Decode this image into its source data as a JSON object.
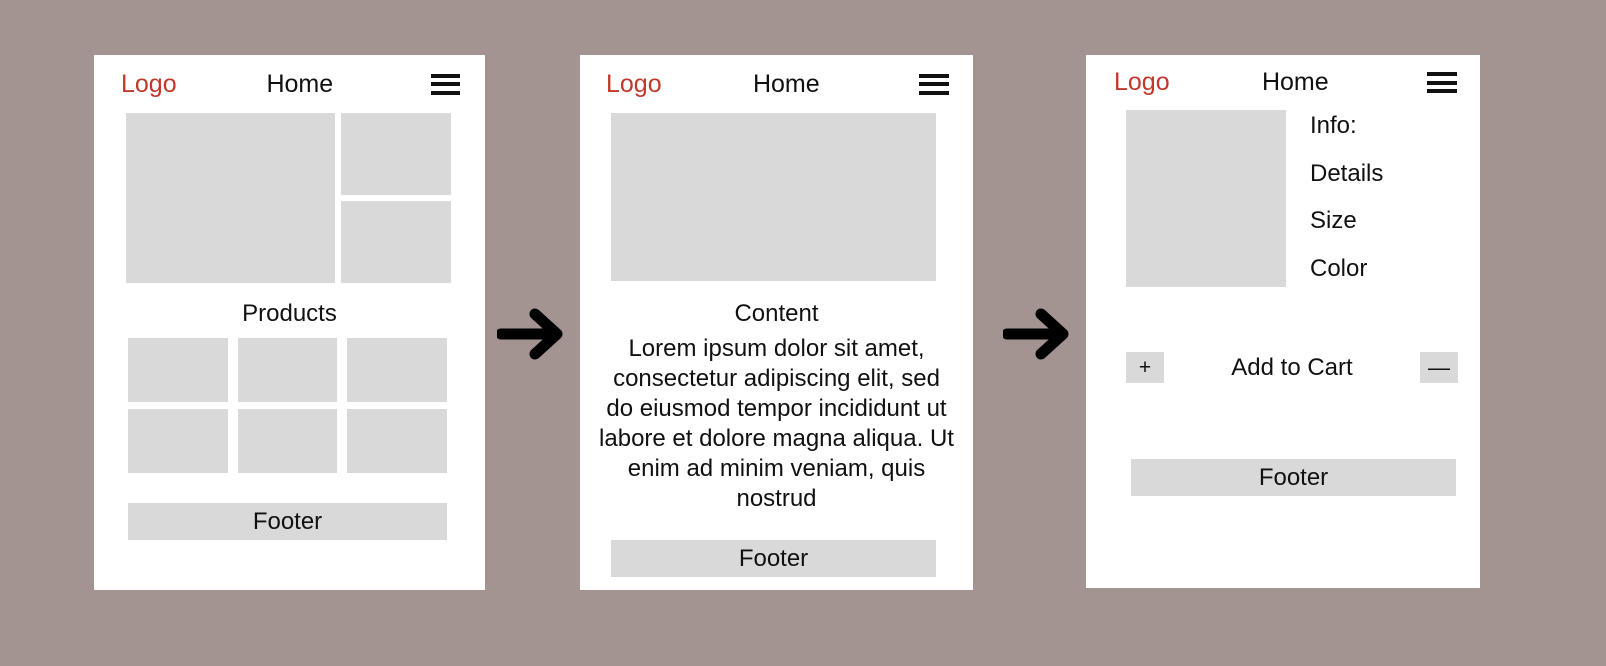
{
  "canvas": {
    "background_color": "#a39391",
    "placeholder_color": "#d9d9d9",
    "accent_color": "#c0392b",
    "text_color": "#111111"
  },
  "flow": {
    "arrow_1": "→",
    "arrow_2": "→"
  },
  "screens": [
    {
      "id": "home",
      "header": {
        "logo": "Logo",
        "nav_title": "Home",
        "menu_icon": "hamburger-icon"
      },
      "hero": {
        "main_placeholder": "",
        "side_placeholders": [
          "",
          ""
        ]
      },
      "section_title": "Products",
      "products": [
        "",
        "",
        "",
        "",
        "",
        ""
      ],
      "footer": "Footer"
    },
    {
      "id": "content",
      "header": {
        "logo": "Logo",
        "nav_title": "Home",
        "menu_icon": "hamburger-icon"
      },
      "hero": {
        "main_placeholder": ""
      },
      "section_title": "Content",
      "body_copy": "Lorem ipsum dolor sit amet, consectetur adipiscing elit, sed do eiusmod tempor incididunt ut labore et dolore magna aliqua. Ut enim ad minim veniam, quis nostrud",
      "footer": "Footer"
    },
    {
      "id": "product-detail",
      "header": {
        "logo": "Logo",
        "nav_title": "Home",
        "menu_icon": "hamburger-icon"
      },
      "thumbnail_placeholder": "",
      "specs": [
        "Info:",
        "Details",
        "Size",
        "Color"
      ],
      "cart": {
        "increase_label": "+",
        "action_label": "Add to Cart",
        "decrease_label": "—"
      },
      "footer": "Footer"
    }
  ]
}
